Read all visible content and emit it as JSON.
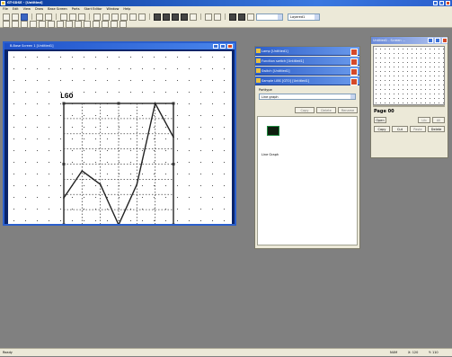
{
  "app": {
    "title": "GT-SDSE - [Untitled]",
    "window_buttons": [
      "minimize",
      "maximize",
      "close"
    ]
  },
  "menu": [
    "File",
    "Edit",
    "View",
    "Draw",
    "Base Screen",
    "Parts",
    "Start Editor",
    "Window",
    "Help"
  ],
  "toolbar": {
    "layer_combo": "",
    "screen_combo": "Layered1"
  },
  "document": {
    "title": "B-Base Screen 1 [Untitled1]",
    "graph_label": "LGO"
  },
  "panel": {
    "items": [
      "Lamp [Untitled1]",
      "Function switch [Untitled1]",
      "Switch [Untitled1]",
      "Sample LIBS [GTO] [Untitled1]"
    ],
    "parttype_label": "Parttype",
    "parttype_value": "Line graph",
    "buttons": [
      "Copy",
      "Delete",
      "Rename"
    ],
    "part_caption": "Line Graph"
  },
  "thumbnail": {
    "title": "Untitled1 - Screen ...",
    "page_label": "Page 00",
    "row1_buttons": [
      "Open",
      "Lib",
      "All"
    ],
    "row2_buttons": [
      "Copy",
      "Cut",
      "Paste",
      "Delete"
    ]
  },
  "status": {
    "left": "Ready",
    "fields": [
      "NUM",
      "X: 120",
      "Y: 110"
    ]
  },
  "chart_data": {
    "type": "line",
    "title": "",
    "x": [
      0,
      1,
      2,
      3,
      4,
      5,
      6
    ],
    "values": [
      0.1,
      0.5,
      0.3,
      -0.3,
      0.3,
      1.5,
      1.0
    ],
    "ylim": [
      -0.3,
      1.5
    ],
    "grid": true
  }
}
